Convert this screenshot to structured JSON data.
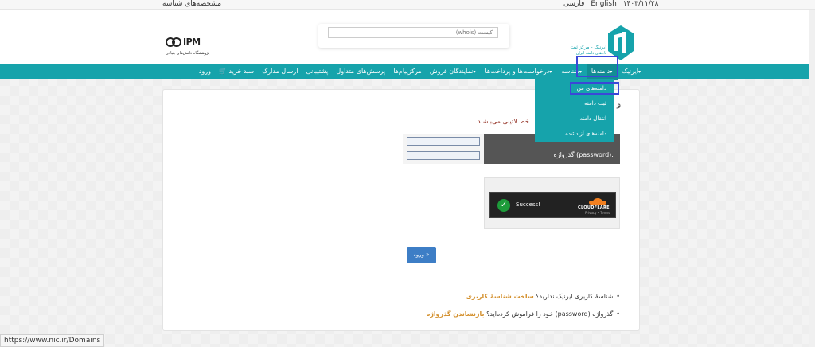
{
  "topbar": {
    "profile_label": "مشخصه‌های شناسه",
    "date": "۱۴۰۳/۱۱/۲۸",
    "lang_english": "English",
    "lang_farsi": "فارسی"
  },
  "header": {
    "search_placeholder": "کیست (whois)",
    "ipm_logo_text": "IPM",
    "ipm_logo_subtitle": "پژوهشگاه دانش‌های بنیادی",
    "irnic_line1": "ایرنیک - مرکز ثبت",
    "irnic_line2": "نام‌های دامنه ایران"
  },
  "nav": {
    "items": [
      {
        "label": "ایرنیک",
        "caret": true
      },
      {
        "label": "دامنه‌ها",
        "caret": true
      },
      {
        "label": "شناسه",
        "caret": true
      },
      {
        "label": "درخواست‌ها و پرداخت‌ها",
        "caret": true
      },
      {
        "label": "نمایندگان فروش",
        "caret": true
      },
      {
        "label": "مرکزپیام‌ها",
        "caret": false
      },
      {
        "label": "پرسش‌های متداول",
        "caret": false
      },
      {
        "label": "پشتیبانی",
        "caret": false
      },
      {
        "label": "ارسال مدارک",
        "caret": false
      },
      {
        "label": "سبد خرید",
        "caret": false,
        "icon": "cart-icon"
      },
      {
        "label": "ورود",
        "caret": false
      }
    ],
    "dropdown": [
      "دامنه‌های من",
      "ثبت دامنه",
      "انتقال دامنه",
      "دامنه‌های آزادشده"
    ]
  },
  "form": {
    "title_peek": "و",
    "latin_note": "خط لاتینی می‌باشند.",
    "password_label": "گذرواژه (password):",
    "captcha_status": "Success!",
    "captcha_brand": "CLOUDFLARE",
    "captcha_links": "Privacy • Terms",
    "login_button": "ورود »"
  },
  "help": {
    "line1_text": "شناسهٔ کاربری ایرنیک ندارید؟",
    "line1_link": "ساخت شناسهٔ کاربری",
    "line2_text": "گذرواژه (password) خود را فراموش کرده‌اید؟",
    "line2_link": "بازنشاندن گذرواژه"
  },
  "status_bar_url": "https://www.nic.ir/Domains"
}
